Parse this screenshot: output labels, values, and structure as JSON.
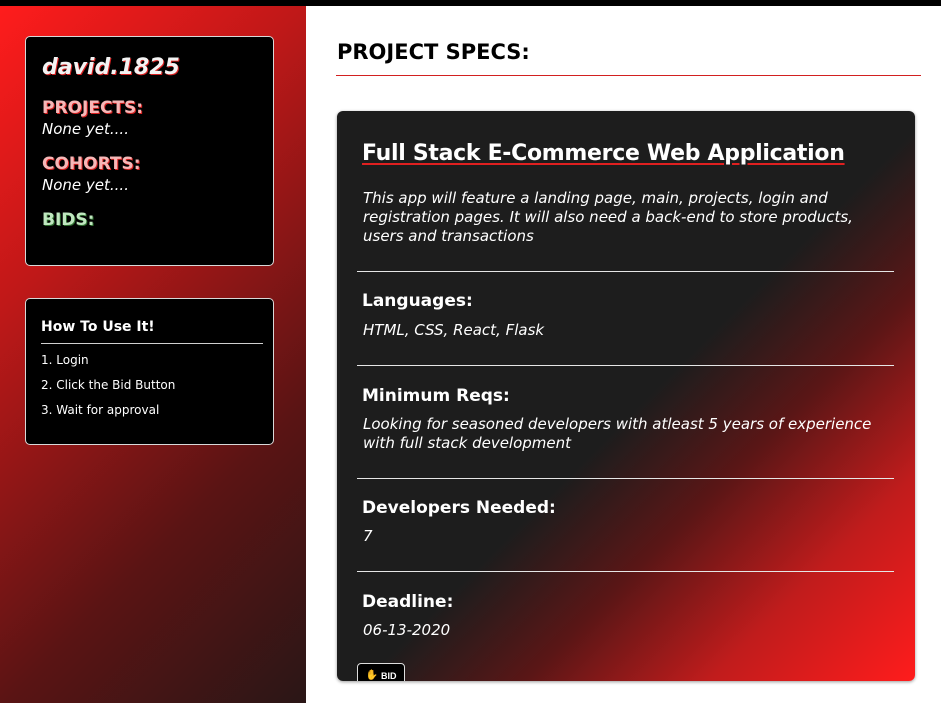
{
  "profile": {
    "username": "david.1825",
    "projects_label": "PROJECTS:",
    "projects_value": "None yet....",
    "cohorts_label": "COHORTS:",
    "cohorts_value": "None yet....",
    "bids_label": "BIDS:"
  },
  "howto": {
    "title": "How To Use It!",
    "steps": [
      "1. Login",
      "2. Click the Bid Button",
      "3. Wait for approval"
    ]
  },
  "main": {
    "title": "PROJECT SPECS:"
  },
  "project": {
    "title": "Full Stack E-Commerce Web Application",
    "description": "This app will feature a landing page, main, projects, login and registration pages. It will also need a back-end to store products, users and transactions",
    "languages_label": "Languages:",
    "languages_value": "HTML, CSS, React, Flask",
    "reqs_label": "Minimum Reqs:",
    "reqs_value": "Looking for seasoned developers with atleast 5 years of experience with full stack development",
    "devs_label": "Developers Needed:",
    "devs_value": "7",
    "deadline_label": "Deadline:",
    "deadline_value": "06-13-2020",
    "bid_button_label": "BID",
    "bid_icon": "hand-icon"
  },
  "colors": {
    "accent_red": "#ff1c1c",
    "card_dark": "#1d1d1d",
    "pink_label": "#f6b7b7",
    "green_label": "#bfe7bf"
  }
}
